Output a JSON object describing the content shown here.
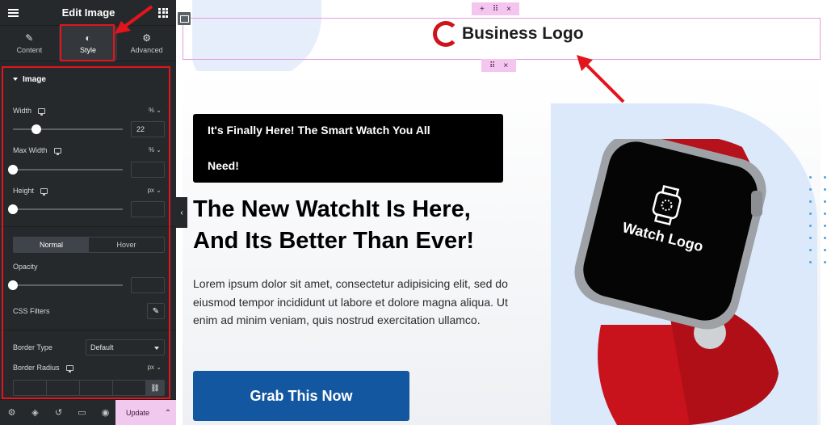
{
  "sidebar": {
    "title": "Edit Image",
    "tabs": [
      {
        "label": "Content",
        "icon": "pencil-icon",
        "glyph": "✎"
      },
      {
        "label": "Style",
        "icon": "contrast-icon",
        "glyph": "◐"
      },
      {
        "label": "Advanced",
        "icon": "gear-icon",
        "glyph": "⚙"
      }
    ],
    "section_title": "Image",
    "width": {
      "label": "Width",
      "unit": "%",
      "value": "22"
    },
    "max_width": {
      "label": "Max Width",
      "unit": "%",
      "value": ""
    },
    "height": {
      "label": "Height",
      "unit": "px",
      "value": ""
    },
    "state_tabs": {
      "normal": "Normal",
      "hover": "Hover"
    },
    "opacity": {
      "label": "Opacity",
      "value": ""
    },
    "css_filters": {
      "label": "CSS Filters"
    },
    "border_type": {
      "label": "Border Type",
      "value": "Default"
    },
    "border_radius": {
      "label": "Border Radius",
      "unit": "px"
    },
    "footer": {
      "update_label": "Update"
    }
  },
  "canvas": {
    "logo_text": "Business Logo",
    "badge_text_1": "It's Finally Here! The Smart Watch You All",
    "badge_text_2": "Need!",
    "headline_1": "The New WatchIt Is Here,",
    "headline_2": "And Its Better Than Ever!",
    "paragraph": "Lorem ipsum dolor sit amet, consectetur adipisicing elit, sed do eiusmod tempor incididunt ut labore et dolore magna aliqua. Ut enim ad minim veniam, quis nostrud exercitation ullamco.",
    "cta_label": "Grab This Now",
    "watch_logo_text": "Watch Logo"
  },
  "colors": {
    "accent_red": "#e4141c",
    "cta_blue": "#1357a0",
    "watch_red": "#c8131d",
    "section_pink": "#f4c6ef"
  }
}
